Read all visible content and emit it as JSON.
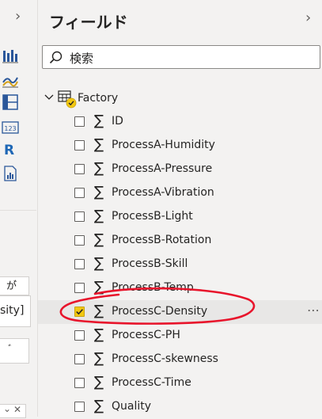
{
  "left_panel": {
    "fragments": {
      "frag1": "が゙",
      "frag2": "sity]",
      "frag3": "゙"
    }
  },
  "fields_pane": {
    "title": "フィールド",
    "search_placeholder": "検索",
    "table": {
      "name": "Factory"
    },
    "fields": [
      {
        "label": "ID",
        "checked": false
      },
      {
        "label": "ProcessA-Humidity",
        "checked": false
      },
      {
        "label": "ProcessA-Pressure",
        "checked": false
      },
      {
        "label": "ProcessA-Vibration",
        "checked": false
      },
      {
        "label": "ProcessB-Light",
        "checked": false
      },
      {
        "label": "ProcessB-Rotation",
        "checked": false
      },
      {
        "label": "ProcessB-Skill",
        "checked": false
      },
      {
        "label": "ProcessB-Temp",
        "checked": false
      },
      {
        "label": "ProcessC-Density",
        "checked": true
      },
      {
        "label": "ProcessC-PH",
        "checked": false
      },
      {
        "label": "ProcessC-skewness",
        "checked": false
      },
      {
        "label": "ProcessC-Time",
        "checked": false
      },
      {
        "label": "Quality",
        "checked": false
      }
    ],
    "more_options": "⋯"
  },
  "colors": {
    "accent_yellow": "#f2c811",
    "annotation_red": "#e8142b"
  }
}
